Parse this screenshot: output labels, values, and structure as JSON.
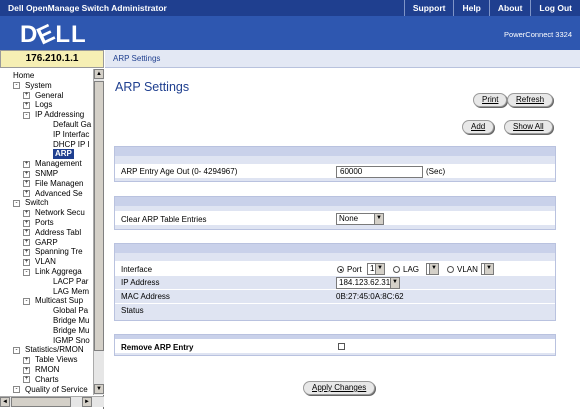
{
  "app": {
    "title": "Dell OpenManage Switch Administrator",
    "model": "PowerConnect 3324",
    "logo": "DELL"
  },
  "toplinks": [
    "Support",
    "Help",
    "About",
    "Log Out"
  ],
  "ip": "176.210.1.1",
  "breadcrumb": "ARP Settings",
  "page_title": "ARP Settings",
  "buttons": {
    "print": "Print",
    "refresh": "Refresh",
    "add": "Add",
    "show_all": "Show All",
    "apply": "Apply Changes"
  },
  "tree": [
    {
      "label": "Home",
      "depth": 0,
      "pm": ""
    },
    {
      "label": "System",
      "depth": 1,
      "pm": "-"
    },
    {
      "label": "General",
      "depth": 2,
      "pm": "+"
    },
    {
      "label": "Logs",
      "depth": 2,
      "pm": "+"
    },
    {
      "label": "IP Addressing",
      "depth": 2,
      "pm": "-"
    },
    {
      "label": "Default Ga",
      "depth": 3,
      "pm": ""
    },
    {
      "label": "IP Interfac",
      "depth": 3,
      "pm": ""
    },
    {
      "label": "DHCP IP I",
      "depth": 3,
      "pm": ""
    },
    {
      "label": "ARP",
      "depth": 3,
      "pm": "",
      "selected": true
    },
    {
      "label": "Management",
      "depth": 2,
      "pm": "+"
    },
    {
      "label": "SNMP",
      "depth": 2,
      "pm": "+"
    },
    {
      "label": "File Managen",
      "depth": 2,
      "pm": "+"
    },
    {
      "label": "Advanced Se",
      "depth": 2,
      "pm": "+"
    },
    {
      "label": "Switch",
      "depth": 1,
      "pm": "-"
    },
    {
      "label": "Network Secu",
      "depth": 2,
      "pm": "+"
    },
    {
      "label": "Ports",
      "depth": 2,
      "pm": "+"
    },
    {
      "label": "Address Tabl",
      "depth": 2,
      "pm": "+"
    },
    {
      "label": "GARP",
      "depth": 2,
      "pm": "+"
    },
    {
      "label": "Spanning Tre",
      "depth": 2,
      "pm": "+"
    },
    {
      "label": "VLAN",
      "depth": 2,
      "pm": "+"
    },
    {
      "label": "Link Aggrega",
      "depth": 2,
      "pm": "-"
    },
    {
      "label": "LACP Par",
      "depth": 3,
      "pm": ""
    },
    {
      "label": "LAG Mem",
      "depth": 3,
      "pm": ""
    },
    {
      "label": "Multicast Sup",
      "depth": 2,
      "pm": "-"
    },
    {
      "label": "Global Pa",
      "depth": 3,
      "pm": ""
    },
    {
      "label": "Bridge Mu",
      "depth": 3,
      "pm": ""
    },
    {
      "label": "Bridge Mu",
      "depth": 3,
      "pm": ""
    },
    {
      "label": "IGMP Sno",
      "depth": 3,
      "pm": ""
    },
    {
      "label": "Statistics/RMON",
      "depth": 1,
      "pm": "-"
    },
    {
      "label": "Table Views",
      "depth": 2,
      "pm": "+"
    },
    {
      "label": "RMON",
      "depth": 2,
      "pm": "+"
    },
    {
      "label": "Charts",
      "depth": 2,
      "pm": "+"
    },
    {
      "label": "Quality of Service",
      "depth": 1,
      "pm": "-"
    }
  ],
  "form": {
    "age_label": "ARP Entry Age Out (0- 4294967)",
    "age_value": "60000",
    "age_unit": "(Sec)",
    "clear_label": "Clear ARP Table Entries",
    "clear_value": "None",
    "interface_label": "Interface",
    "port_label": "Port",
    "port_value": "1",
    "lag_label": "LAG",
    "vlan_label": "VLAN",
    "ip_label": "IP Address",
    "ip_value": "184.123.62.31",
    "mac_label": "MAC Address",
    "mac_value": "0B:27:45:0A:8C:62",
    "status_label": "Status",
    "remove_label": "Remove ARP Entry"
  },
  "colors": {
    "titlebar": "#1f3f8f",
    "banner": "#2e57b0",
    "section": "#dfe4f2",
    "ipbox": "#f6efb4"
  }
}
